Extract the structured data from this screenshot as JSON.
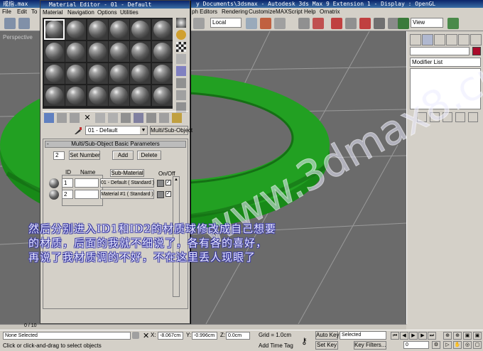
{
  "max_window": {
    "title_left": "戒指.max",
    "title_right": "y Documents\\3dsmax   -  Autodesk 3ds Max 9 Extension 1        - Display : OpenGL",
    "menu_left": [
      "File",
      "Edit",
      "To"
    ],
    "menu_right": [
      "ph Editors",
      "Rendering",
      "Customize",
      "MAXScript",
      "Help",
      "Ornatrix"
    ],
    "coord_system": "Local",
    "viewport_select": "View",
    "viewport_label": "Perspective"
  },
  "material_editor": {
    "title": "Material Editor - 01 - Default",
    "menu": [
      "Material",
      "Navigation",
      "Options",
      "Utilities"
    ],
    "material_name": "01 - Default",
    "material_type": "Multi/Sub-Object",
    "rollout_title": "Multi/Sub-Object Basic Parameters",
    "rollout_toggle": "-",
    "sub_count": "2",
    "set_number_label": "Set Number",
    "add_label": "Add",
    "delete_label": "Delete",
    "headers": {
      "id": "ID",
      "name": "Name",
      "sub_material": "Sub-Material",
      "on_off": "On/Off"
    },
    "rows": [
      {
        "id": "1",
        "material": "01 - Default ( Standard )",
        "checked": "✓"
      },
      {
        "id": "2",
        "material": "Material #1 ( Standard )",
        "checked": "✓"
      }
    ]
  },
  "command_panel": {
    "modifier_list": "Modifier List"
  },
  "caption": {
    "line1": "然后分别进入ID1和ID2的材质球修改成自己想要",
    "line2": "的材质，后面的我就不细说了，各有各的喜好，",
    "line3": "再说了我材质调的不好，不在这里丢人现眼了"
  },
  "watermark": "www.3dmax8.cn",
  "timeline": {
    "frame": "0 / 10"
  },
  "status": {
    "selection": "None Selected",
    "prompt": "Click or click-and-drag to select objects",
    "x_label": "X:",
    "x_value": "-8.067cm",
    "y_label": "Y:",
    "y_value": "-0.996cm",
    "z_label": "Z:",
    "z_value": "0.0cm",
    "grid": "Grid = 1.0cm",
    "add_time_tag": "Add Time Tag",
    "auto_key": "Auto Key",
    "key_mode": "Selected",
    "set_key": "Set Key",
    "key_filters": "Key Filters...",
    "frame_value": "0"
  },
  "colors": {
    "torus": "#1a8c1a",
    "object_color": "#aa0a2a",
    "title_bar": "#0a246a"
  }
}
